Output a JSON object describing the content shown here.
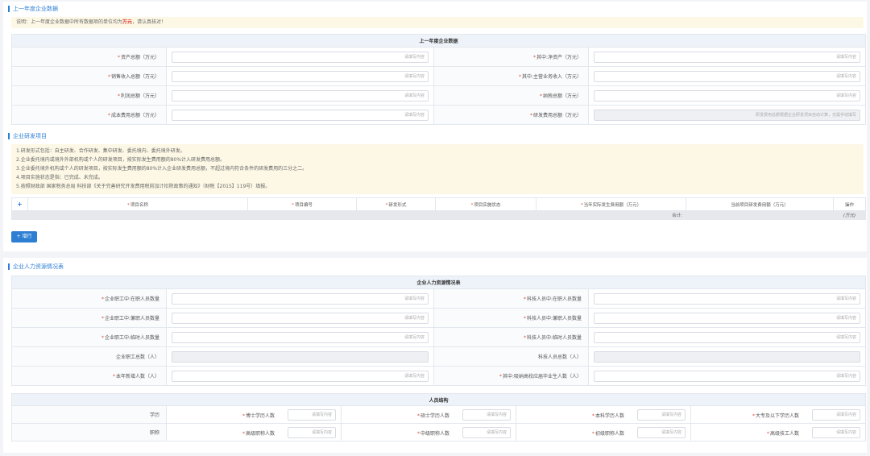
{
  "s1": {
    "title": "上一年度企业数据",
    "note_pre": "说明：上一年度企业数据中所有数据项的单位均为",
    "note_unit": "万元",
    "note_post": "，请认真核对！",
    "table_head": "上一年度企业数据",
    "rows": [
      {
        "l1": "资产总额（万元）",
        "l2": "其中:净资产（万元）"
      },
      {
        "l1": "销售收入总额（万元）",
        "l2": "其中:主营业务收入（万元）"
      },
      {
        "l1": "利润总额（万元）",
        "l2": "纳税总额（万元）"
      },
      {
        "l1": "成本费用总额（万元）",
        "l2": "研发费用总额（万元）"
      }
    ],
    "placeholder": "请填写内容",
    "rd_disabled_text": "研发费用总额根据企业研发项目自动计算，无需手动填写"
  },
  "s2": {
    "title": "企业研发项目",
    "notes": [
      "1.研发形式包括：自主研发、合作研发、集中研发、委托境内、委托境外研发。",
      "2.企业委托境内或境外外部机构或个人的研发项目，按实际发生费用额的80%计入研发费用总额。",
      "3.企业委托境外机构或个人的研发项目，按实际发生费用额的80%计入企业研发费用总额，不超过境内符合条件的研发费用的三分之二。",
      "4.项目实施状态是指：已完成、未完成。",
      "5.按照财政部 国家税务总局 科技部《关于完善研究开发费用税前加计扣除政策的通知》（财税【2015】119号）填报。"
    ],
    "columns": [
      "项目名称",
      "项目编号",
      "研发形式",
      "项目实施状态",
      "当年实际发生费用额（万元）",
      "当前项目研发费用额（万元）",
      "操作"
    ],
    "sum_label": "合计:",
    "sum_unit": "(万元)",
    "add_label": "+ 增行"
  },
  "s3": {
    "title": "企业人力资源情况表",
    "table_head": "企业人力资源情况表",
    "rows": [
      {
        "l1": "企业职工中:在职人员数量",
        "l2": "科技人员中:在职人员数量",
        "req1": true,
        "req2": true
      },
      {
        "l1": "企业职工中:兼职人员数量",
        "l2": "科技人员中:兼职人员数量",
        "req1": true,
        "req2": true
      },
      {
        "l1": "企业职工中:临时人员数量",
        "l2": "科技人员中:临时人员数量",
        "req1": true,
        "req2": true
      },
      {
        "l1": "企业职工总数（人）",
        "l2": "科技人员总数（人）",
        "req1": false,
        "req2": false
      },
      {
        "l1": "本年新增人数（人）",
        "l2": "其中:吸纳高校应届毕业生人数（人）",
        "req1": true,
        "req2": true
      }
    ],
    "placeholder": "请填写内容"
  },
  "s4": {
    "table_head": "人员结构",
    "edu_label": "学历",
    "edu": [
      "博士学历人数",
      "硕士学历人数",
      "本科学历人数",
      "大专及以下学历人数"
    ],
    "title_label": "职称",
    "titles": [
      "高级职称人数",
      "中级职称人数",
      "初级职称人数",
      "高级技工人数"
    ],
    "placeholder": "请填写内容"
  }
}
